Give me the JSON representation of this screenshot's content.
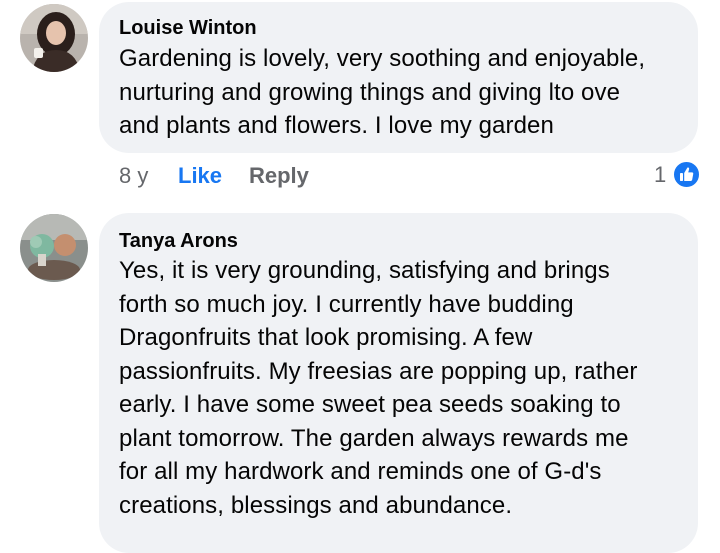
{
  "comments": [
    {
      "author": "Louise Winton",
      "text": "Gardening is lovely, very soothing and enjoyable,\nnurturing and growing things and giving lto ove\nand plants and flowers.   I love my garden",
      "time": "8 y",
      "like_label": "Like",
      "reply_label": "Reply",
      "reaction_count": "1",
      "reaction_icon": "thumbs-up-icon"
    },
    {
      "author": "Tanya Arons",
      "text": "Yes, it is very grounding, satisfying and brings\nforth so much joy.  I currently have budding\nDragonfruits that look promising.  A few\npassionfruits. My freesias are popping up, rather\nearly.  I have some sweet pea seeds soaking to\nplant tomorrow. The garden always rewards me\nfor all my hardwork and reminds one of G-d's\ncreations, blessings and abundance."
    }
  ],
  "colors": {
    "bubble": "#f0f2f5",
    "accent": "#1877f2",
    "secondary_text": "#65676b"
  }
}
